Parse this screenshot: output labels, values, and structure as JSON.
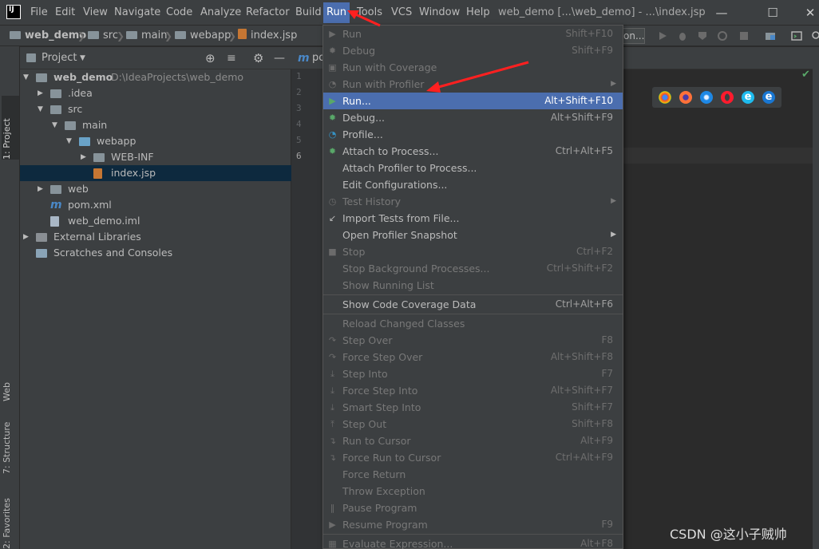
{
  "title_bar": {
    "menus": [
      "File",
      "Edit",
      "View",
      "Navigate",
      "Code",
      "Analyze",
      "Refactor",
      "Build",
      "Run",
      "Tools",
      "VCS",
      "Window",
      "Help"
    ],
    "active_menu": "Run",
    "window_title": "web_demo [...\\web_demo] - ...\\index.jsp",
    "logo_text": "IJ"
  },
  "breadcrumb": {
    "items": [
      "web_demo",
      "src",
      "main",
      "webapp",
      "index.jsp"
    ],
    "run_config_text": "on..."
  },
  "tool_windows": {
    "left": [
      "1: Project",
      "Web",
      "7: Structure",
      "2: Favorites"
    ]
  },
  "project_panel": {
    "header": "Project",
    "tree": [
      {
        "label": "web_demo",
        "extra": "D:\\IdeaProjects\\web_demo",
        "depth": 0,
        "expanded": true,
        "icon": "module-folder-icon",
        "bold": true
      },
      {
        "label": ".idea",
        "depth": 1,
        "expanded": false,
        "icon": "folder-icon"
      },
      {
        "label": "src",
        "depth": 1,
        "expanded": true,
        "icon": "folder-icon"
      },
      {
        "label": "main",
        "depth": 2,
        "expanded": true,
        "icon": "folder-icon"
      },
      {
        "label": "webapp",
        "depth": 3,
        "expanded": true,
        "icon": "web-folder-icon"
      },
      {
        "label": "WEB-INF",
        "depth": 4,
        "expanded": false,
        "icon": "folder-icon"
      },
      {
        "label": "index.jsp",
        "depth": 4,
        "icon": "jsp-file-icon",
        "selected": true
      },
      {
        "label": "web",
        "depth": 1,
        "expanded": false,
        "icon": "folder-icon"
      },
      {
        "label": "pom.xml",
        "depth": 1,
        "icon": "maven-file-icon"
      },
      {
        "label": "web_demo.iml",
        "depth": 1,
        "icon": "iml-file-icon"
      },
      {
        "label": "External Libraries",
        "depth": 0,
        "expanded": false,
        "icon": "libraries-icon"
      },
      {
        "label": "Scratches and Consoles",
        "depth": 0,
        "icon": "scratches-icon"
      }
    ]
  },
  "editor": {
    "tab_label": "po",
    "line_numbers": [
      "1",
      "2",
      "3",
      "4",
      "5",
      "6"
    ]
  },
  "run_menu": {
    "items": [
      {
        "label": "Run",
        "shortcut": "Shift+F10",
        "disabled": true,
        "icon": "run-icon"
      },
      {
        "label": "Debug",
        "shortcut": "Shift+F9",
        "disabled": true,
        "icon": "debug-icon"
      },
      {
        "label": "Run with Coverage",
        "disabled": true,
        "icon": "coverage-icon"
      },
      {
        "label": "Run with Profiler",
        "disabled": true,
        "submenu": true,
        "icon": "profiler-icon"
      },
      {
        "label": "Run...",
        "shortcut": "Alt+Shift+F10",
        "highlighted": true,
        "icon": "run-icon"
      },
      {
        "label": "Debug...",
        "shortcut": "Alt+Shift+F9",
        "icon": "debug-icon"
      },
      {
        "label": "Profile...",
        "icon": "profile-icon"
      },
      {
        "label": "Attach to Process...",
        "shortcut": "Ctrl+Alt+F5",
        "icon": "attach-icon"
      },
      {
        "label": "Attach Profiler to Process..."
      },
      {
        "label": "Edit Configurations..."
      },
      {
        "label": "Test History",
        "disabled": true,
        "submenu": true,
        "icon": "history-icon"
      },
      {
        "label": "Import Tests from File...",
        "icon": "import-icon"
      },
      {
        "label": "Open Profiler Snapshot",
        "submenu": true
      },
      {
        "label": "Stop",
        "shortcut": "Ctrl+F2",
        "disabled": true,
        "icon": "stop-icon"
      },
      {
        "label": "Stop Background Processes...",
        "shortcut": "Ctrl+Shift+F2",
        "disabled": true
      },
      {
        "label": "Show Running List",
        "disabled": true
      },
      {
        "label": "Show Code Coverage Data",
        "shortcut": "Ctrl+Alt+F6",
        "separator_before": true
      },
      {
        "label": "Reload Changed Classes",
        "disabled": true,
        "separator_before": true
      },
      {
        "label": "Step Over",
        "shortcut": "F8",
        "disabled": true,
        "icon": "step-over-icon"
      },
      {
        "label": "Force Step Over",
        "shortcut": "Alt+Shift+F8",
        "disabled": true,
        "icon": "force-step-over-icon"
      },
      {
        "label": "Step Into",
        "shortcut": "F7",
        "disabled": true,
        "icon": "step-into-icon"
      },
      {
        "label": "Force Step Into",
        "shortcut": "Alt+Shift+F7",
        "disabled": true,
        "icon": "force-step-into-icon"
      },
      {
        "label": "Smart Step Into",
        "shortcut": "Shift+F7",
        "disabled": true,
        "icon": "smart-step-into-icon"
      },
      {
        "label": "Step Out",
        "shortcut": "Shift+F8",
        "disabled": true,
        "icon": "step-out-icon"
      },
      {
        "label": "Run to Cursor",
        "shortcut": "Alt+F9",
        "disabled": true,
        "icon": "run-to-cursor-icon"
      },
      {
        "label": "Force Run to Cursor",
        "shortcut": "Ctrl+Alt+F9",
        "disabled": true,
        "icon": "force-run-to-cursor-icon"
      },
      {
        "label": "Force Return",
        "disabled": true
      },
      {
        "label": "Throw Exception",
        "disabled": true
      },
      {
        "label": "Pause Program",
        "disabled": true,
        "icon": "pause-icon"
      },
      {
        "label": "Resume Program",
        "shortcut": "F9",
        "disabled": true,
        "icon": "resume-icon"
      },
      {
        "label": "Evaluate Expression...",
        "shortcut": "Alt+F8",
        "disabled": true,
        "separator_before": true,
        "icon": "evaluate-icon"
      }
    ]
  },
  "browser_icons": [
    "chrome-icon",
    "firefox-icon",
    "safari-icon",
    "opera-icon",
    "ie-icon",
    "edge-icon"
  ],
  "watermark": "CSDN @这小子贼帅",
  "colors": {
    "highlight": "#4b6eaf",
    "panel": "#3c3f41",
    "editor": "#2b2b2b",
    "annotation": "#ff2020"
  }
}
